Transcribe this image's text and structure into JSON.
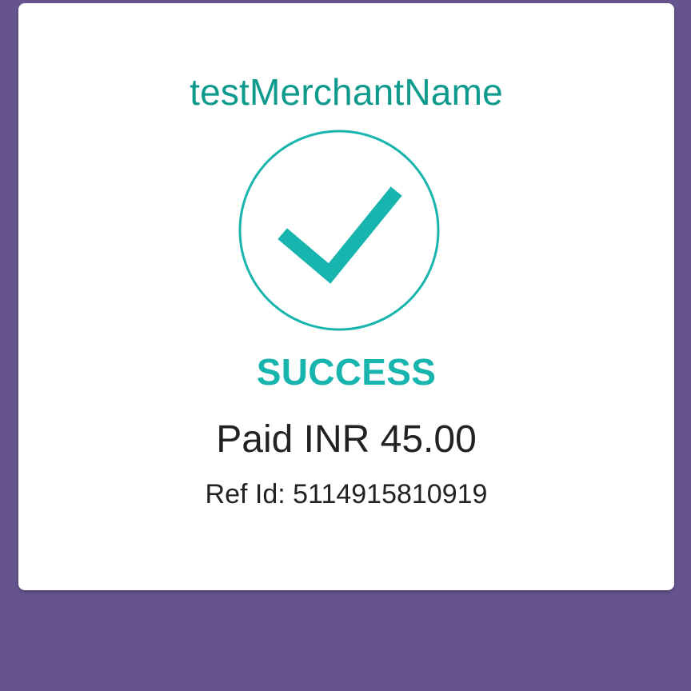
{
  "receipt": {
    "merchant_name": "testMerchantName",
    "status": "SUCCESS",
    "amount_text": "Paid INR 45.00",
    "ref_text": "Ref Id: 5114915810919",
    "status_icon": "checkmark-circle-icon"
  },
  "colors": {
    "background": "#66548f",
    "card": "#ffffff",
    "merchant": "#0e9a8c",
    "success": "#17b5ad",
    "text": "#222222"
  }
}
